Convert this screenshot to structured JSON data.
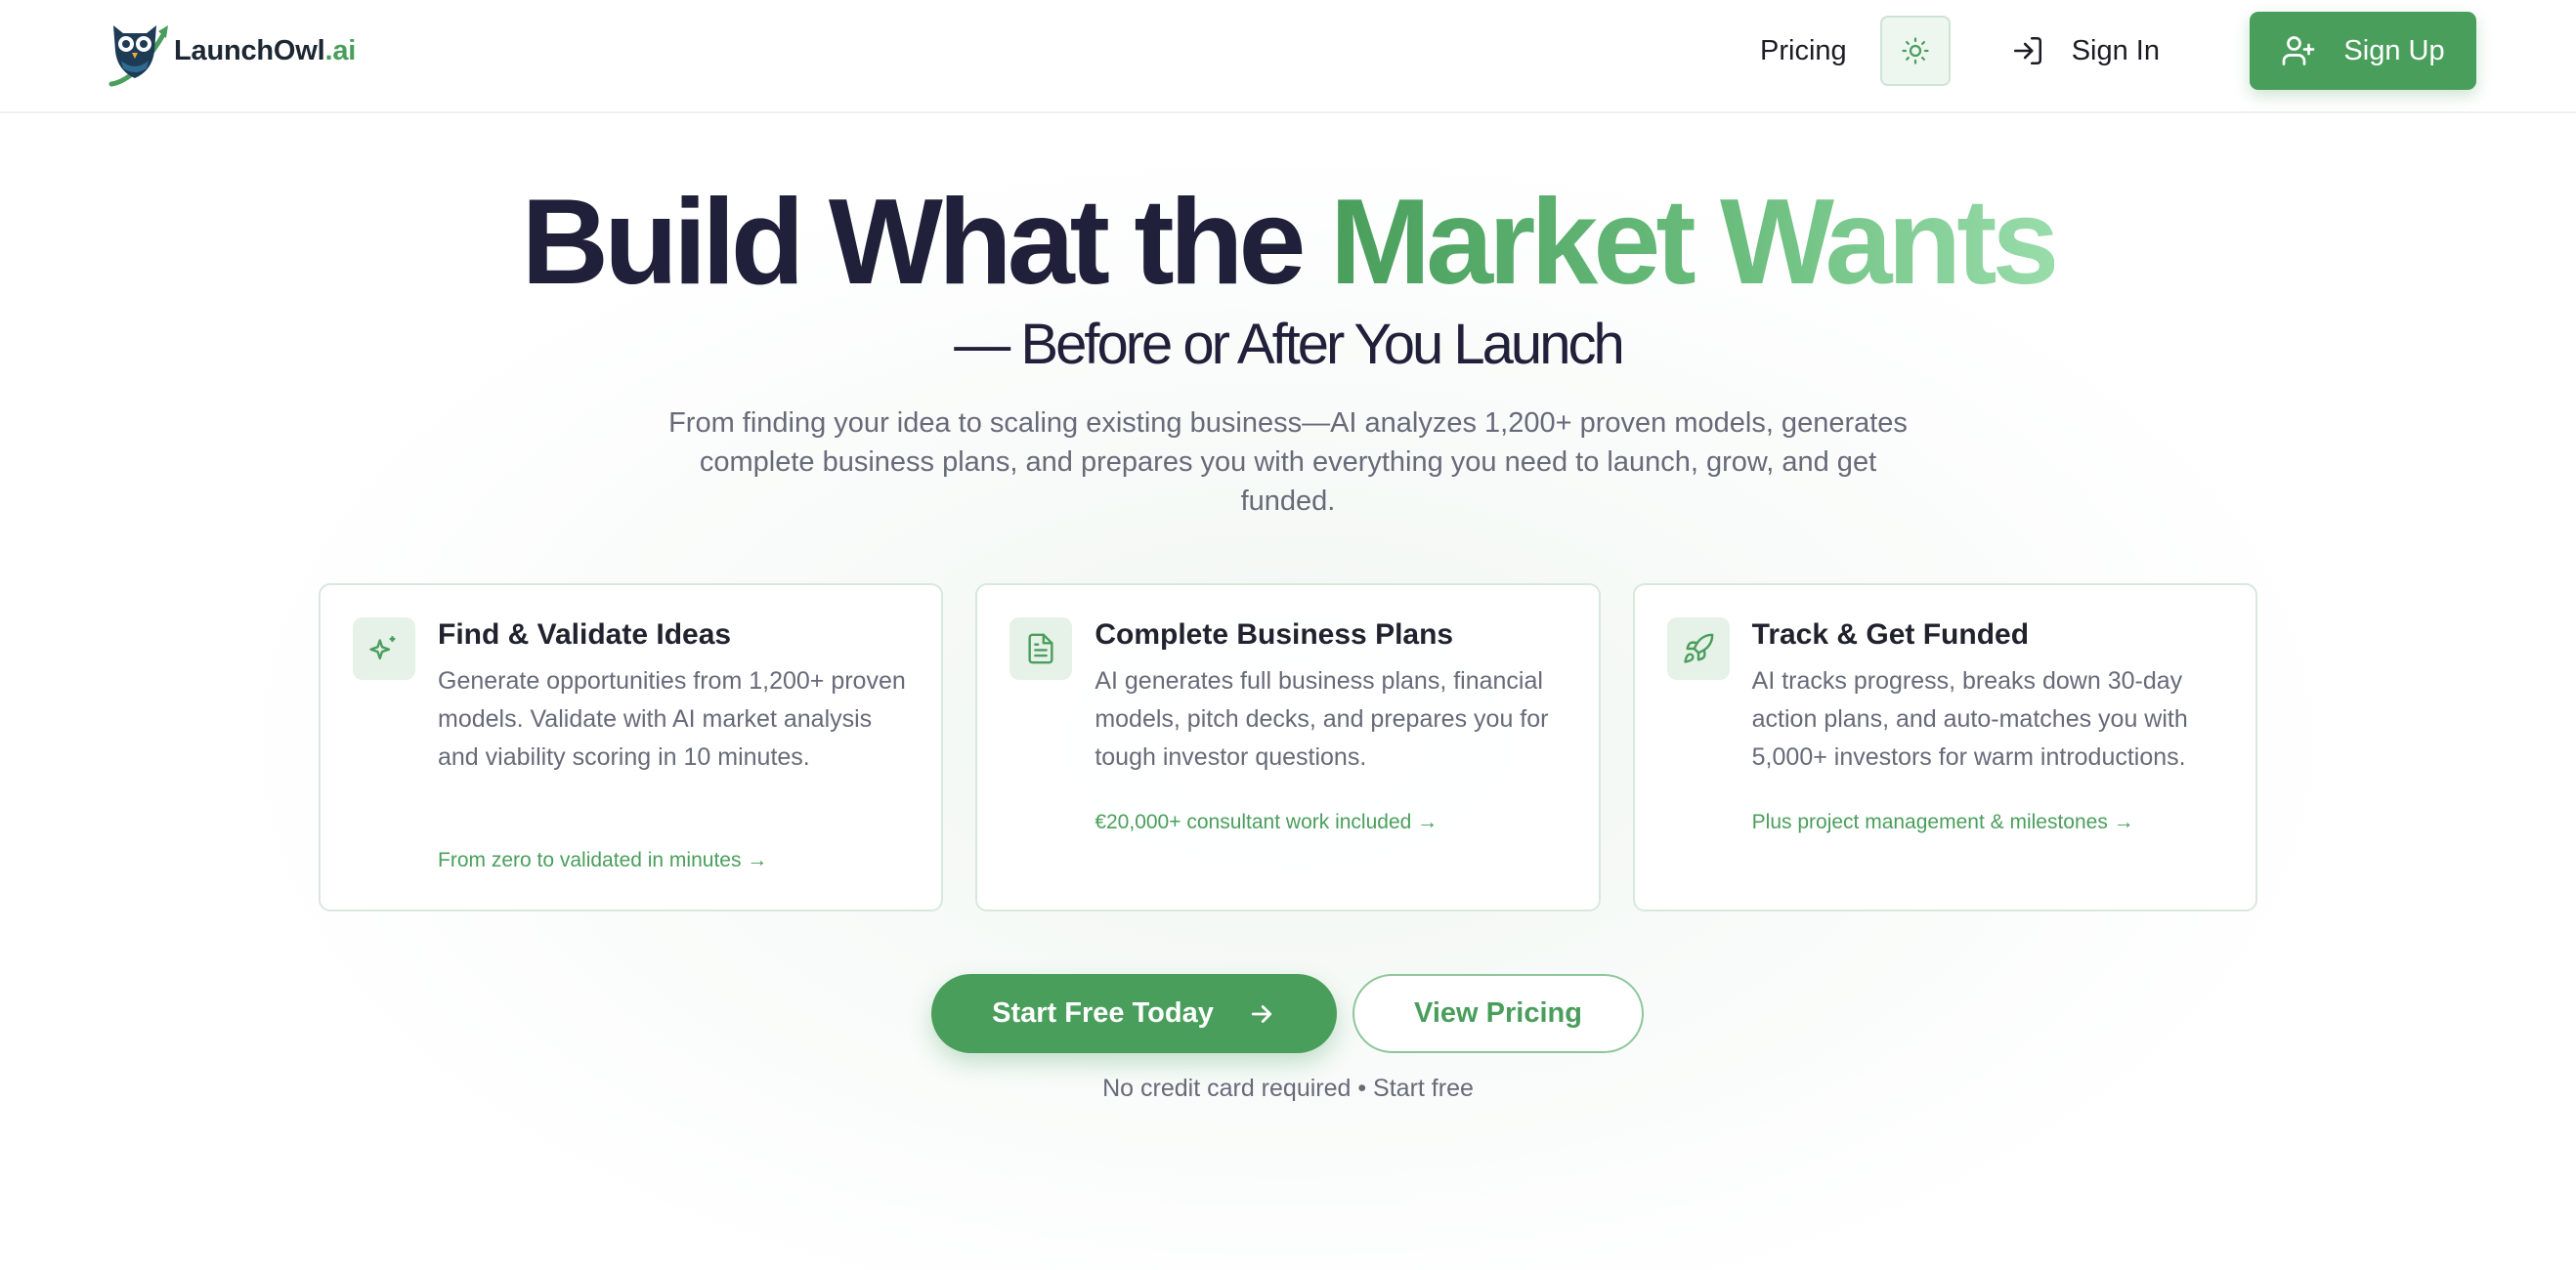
{
  "nav": {
    "brand_name": "LaunchOwl",
    "brand_tld": ".ai",
    "pricing_label": "Pricing",
    "theme_icon": "sun-icon",
    "signin_label": "Sign In",
    "signup_label": "Sign Up"
  },
  "hero": {
    "title_start": "Build What the ",
    "title_accent": "Market Wants",
    "subtitle": "— Before or After You Launch",
    "description": "From finding your idea to scaling existing business—AI analyzes 1,200+ proven models, generates complete business plans, and prepares you with everything you need to launch, grow, and get funded."
  },
  "cards": [
    {
      "icon": "sparkles-icon",
      "title": "Find & Validate Ideas",
      "text": "Generate opportunities from 1,200+ proven models. Validate with AI market analysis and viability scoring in 10 minutes.",
      "link": "From zero to validated in minutes →"
    },
    {
      "icon": "document-icon",
      "title": "Complete Business Plans",
      "text": "AI generates full business plans, financial models, pitch decks, and prepares you for tough investor questions.",
      "link": "€20,000+ consultant work included →"
    },
    {
      "icon": "rocket-icon",
      "title": "Track & Get Funded",
      "text": "AI tracks progress, breaks down 30-day action plans, and auto-matches you with 5,000+ investors for warm introductions.",
      "link": "Plus project management & milestones →"
    }
  ],
  "cta": {
    "primary_label": "Start Free Today",
    "secondary_label": "View Pricing",
    "note": "No credit card required • Start free"
  },
  "colors": {
    "brand_green": "#4a9e5c",
    "text_dark": "#20203a",
    "text_muted": "#676a78"
  }
}
